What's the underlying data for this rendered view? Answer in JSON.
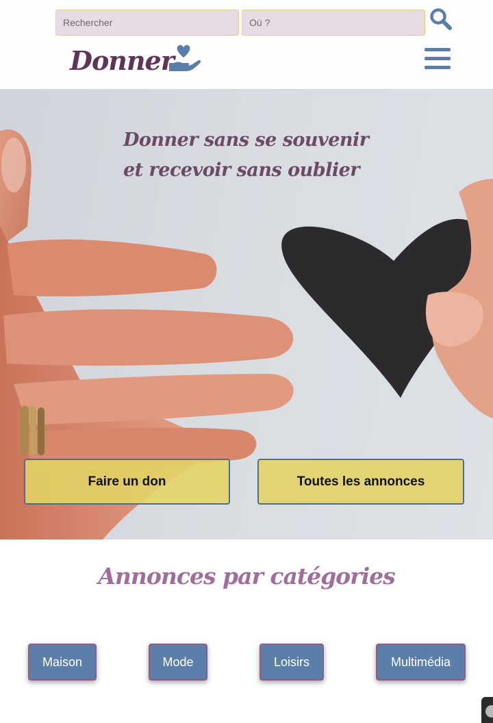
{
  "search": {
    "what_placeholder": "Rechercher",
    "where_placeholder": "Où ?"
  },
  "brand": {
    "name": "Donner"
  },
  "hero": {
    "tagline_line1": "Donner sans se souvenir",
    "tagline_line2": "et recevoir sans oublier",
    "donate_label": "Faire un don",
    "all_ads_label": "Toutes les annonces"
  },
  "categories": {
    "title": "Annonces par catégories",
    "items": [
      {
        "label": "Maison"
      },
      {
        "label": "Mode"
      },
      {
        "label": "Loisirs"
      },
      {
        "label": "Multimédia"
      }
    ]
  },
  "icons": {
    "search": "search-icon",
    "logo": "heart-hand-icon",
    "menu": "hamburger-menu-icon"
  },
  "colors": {
    "brand_purple": "#5e3558",
    "accent_blue": "#5a7ea9",
    "button_yellow": "#e2d474",
    "input_bg": "#e7dbe5"
  }
}
